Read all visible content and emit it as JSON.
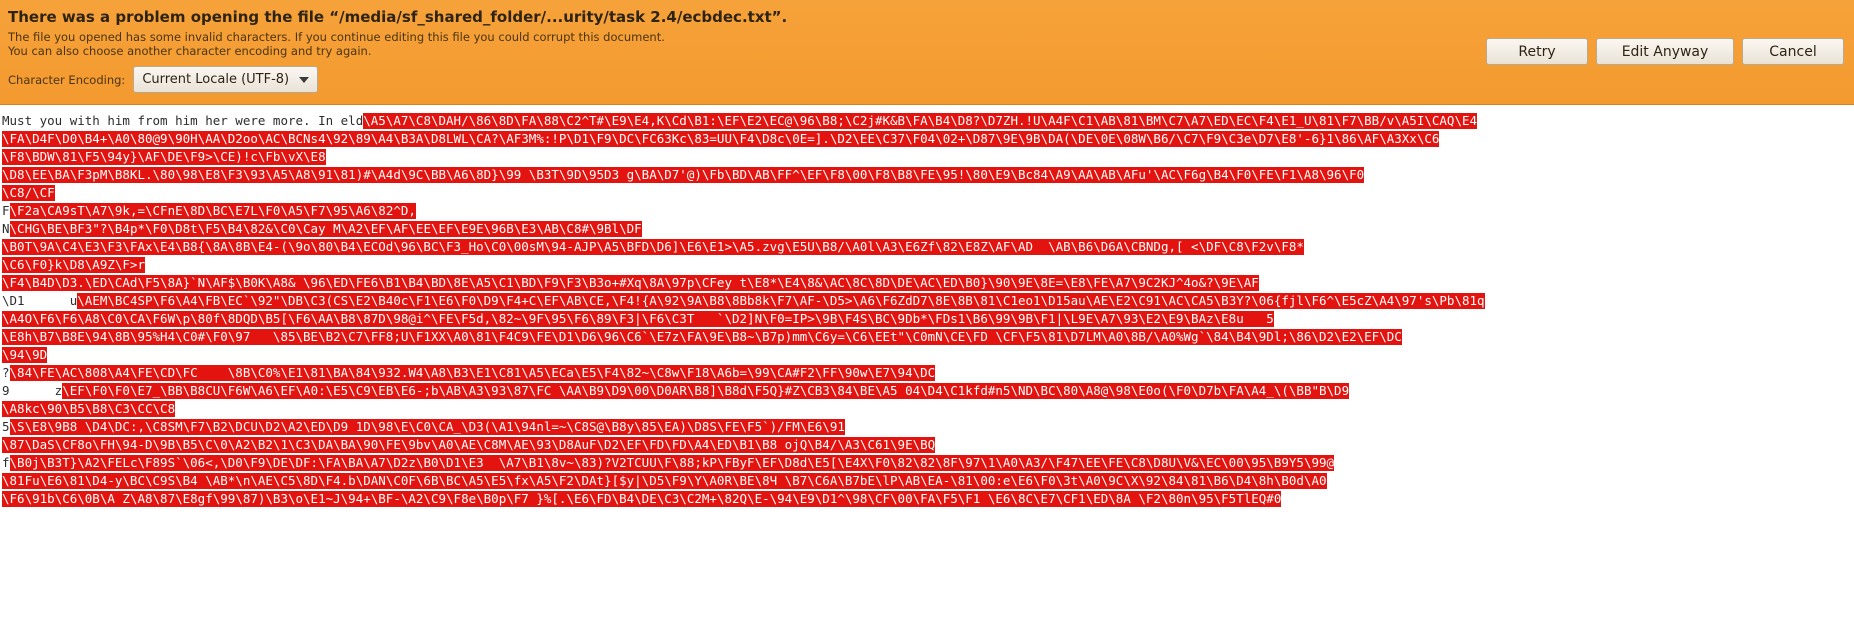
{
  "infobar": {
    "title": "There was a problem opening the file “/media/sf_shared_folder/...urity/task 2.4/ecbdec.txt”.",
    "desc_line1": "The file you opened has some invalid characters. If you continue editing this file you could corrupt this document.",
    "desc_line2": "You can also choose another character encoding and try again.",
    "encoding_label": "Character Encoding:",
    "encoding_value": "Current Locale (UTF-8)",
    "buttons": {
      "retry": "Retry",
      "edit_anyway": "Edit Anyway",
      "cancel": "Cancel"
    }
  },
  "editor": {
    "lines": [
      [
        {
          "t": "txt",
          "v": "Must you with him from him her were more. In eld"
        },
        {
          "t": "bad",
          "v": "\\A5\\A7\\C8\\DAH/\\86\\8D\\FA\\88\\C2^T#\\E9\\E4,K\\Cd\\B1:\\EF\\E2\\EC@\\96\\B8;\\C2j#K&B\\FA\\B4\\D8?\\D7ZH.!U\\A4F\\C1\\AB\\81\\BM\\C7\\A7\\ED\\EC\\F4\\E1_U\\81\\F7\\BB/v\\A5I\\CAQ\\E4"
        }
      ],
      [
        {
          "t": "bad",
          "v": "\\FA\\D4F\\D0\\B4+\\A0\\80@9\\90H\\AA\\D2oo\\AC\\BCNs4\\92\\89\\A4\\B3A\\D8LWL\\CA?\\AF3M%:!P\\D1\\F9\\DC\\FC63Kc\\83=UU\\F4\\D8c\\0E=].\\D2\\EE\\C37\\F04\\02+\\D87\\9E\\9B\\DA(\\DE\\0E\\08W\\B6/\\C7\\F9\\C3e\\D7\\E8'-6}1\\86\\AF\\A3Xx\\C6"
        }
      ],
      [
        {
          "t": "bad",
          "v": "\\F8\\BDW\\81\\F5\\94y}\\AF\\DE\\F9>\\CE)!c\\Fb\\vX\\E8"
        }
      ],
      [
        {
          "t": "bad",
          "v": "\\D8\\EE\\BA\\F3pM\\B8KL.\\80\\98\\E8\\F3\\93\\A5\\A8\\91\\81)#\\A4d\\9C\\BB\\A6\\8D}\\99 \\B3T\\9D\\95D3 g\\BA\\D7'@)\\Fb\\BD\\AB\\FF^\\EF\\F8\\00\\F8\\B8\\FE\\95!\\80\\E9\\Bc84\\A9\\AA\\AB\\AFu'\\AC\\F6g\\B4\\F0\\FE\\F1\\A8\\96\\F0"
        }
      ],
      [
        {
          "t": "bad",
          "v": "\\C8/\\CF"
        }
      ],
      [
        {
          "t": "txt",
          "v": "F"
        },
        {
          "t": "bad",
          "v": "\\F2a\\CA9sT\\A7\\9k,=\\CFnE\\8D\\BC\\E7L\\F0\\A5\\F7\\95\\A6\\82^D,"
        }
      ],
      [
        {
          "t": "txt",
          "v": "N"
        },
        {
          "t": "bad",
          "v": "\\CHG\\BE\\BF3\"?\\B4p*\\F0\\D8t\\F5\\B4\\82&\\C0\\Cay M\\A2\\EF\\AF\\EE\\EF\\E9E\\96B\\E3\\AB\\C8#\\9Bl\\DF"
        }
      ],
      [
        {
          "t": "bad",
          "v": "\\B0T\\9A\\C4\\E3\\F3\\FAx\\E4\\B8{\\8A\\8B\\E4-(\\9o\\80\\B4\\ECOd\\96\\BC\\F3_Ho\\C0\\00sM\\94-AJP\\A5\\BFD\\D6]\\E6\\E1>\\A5.zvg\\E5U\\B8/\\A0l\\A3\\E6Zf\\82\\E8Z\\AF\\AD  \\AB\\B6\\D6A\\CBNDg,[ <\\DF\\C8\\F2v\\F8*"
        }
      ],
      [
        {
          "t": "bad",
          "v": "\\C6\\F0}k\\D8\\A9Z\\F>r"
        }
      ],
      [
        {
          "t": "bad",
          "v": "\\F4\\B4D\\D3.\\ED\\CAd\\F5\\8A}`N\\AF$\\B0K\\A8& \\96\\ED\\FE6\\B1\\B4\\BD\\8E\\A5\\C1\\BD\\F9\\F3\\B3o+#Xq\\8A\\97p\\CFey t\\E8*\\E4\\8&\\AC\\8C\\8D\\DE\\AC\\ED\\B0}\\90\\9E\\8E=\\E8\\FE\\A7\\9C2KJ^4o&?\\9E\\AF"
        }
      ],
      [
        {
          "t": "txt",
          "v": "\\D1      u"
        },
        {
          "t": "bad",
          "v": "\\AEM\\BC4SP\\F6\\A4\\FB\\EC`\\92\"\\DB\\C3(CS\\E2\\B40c\\F1\\E6\\F0\\D9\\F4+C\\EF\\AB\\CE,\\F4!{A\\92\\9A\\B8\\8Bb8k\\F7\\AF-\\D5>\\A6\\F6ZdD7\\8E\\8B\\81\\C1eo1\\D15au\\AE\\E2\\C91\\AC\\CA5\\B3Y?\\06{fjl\\F6^\\E5cZ\\A4\\97's\\Pb\\81q"
        }
      ],
      [
        {
          "t": "bad",
          "v": "\\A4O\\F6\\F6\\A8\\C0\\CA\\F6W\\p\\80f\\8DQD\\B5[\\F6\\AA\\B8\\87D\\98@i^\\FE\\F5d,\\82~\\9F\\95\\F6\\89\\F3|\\F6\\C3T   `\\D2]N\\F0=IP>\\9B\\F4S\\BC\\9Db*\\FDs1\\B6\\99\\9B\\F1|\\L9E\\A7\\93\\E2\\E9\\BAz\\E8u   5"
        }
      ],
      [
        {
          "t": "bad",
          "v": "\\E8h\\B7\\B8E\\94\\8B\\95%H4\\C0#\\F0\\97   \\85\\BE\\B2\\C7\\FF8;U\\F1XX\\A0\\81\\F4C9\\FE\\D1\\D6\\96\\C6`\\E7z\\FA\\9E\\B8~\\B7p)mm\\C6y=\\C6\\EEt\"\\C0mN\\CE\\FD \\CF\\F5\\81\\D7LM\\A0\\8B/\\A0%Wg`\\84\\B4\\9Dl;\\86\\D2\\E2\\EF\\DC"
        }
      ],
      [
        {
          "t": "bad",
          "v": "\\94\\9D"
        }
      ],
      [
        {
          "t": "txt",
          "v": "?"
        },
        {
          "t": "bad",
          "v": "\\84\\FE\\AC\\808\\A4\\FE\\CD\\FC    \\8B\\C0%\\E1\\81\\BA\\84\\932.W4\\A8\\B3\\E1\\C81\\A5\\ECa\\E5\\F4\\82~\\C8w\\F18\\A6b=\\99\\CA#F2\\FF\\90w\\E7\\94\\DC"
        }
      ],
      [
        {
          "t": "txt",
          "v": "9      z"
        },
        {
          "t": "bad",
          "v": "\\EF\\F0\\F0\\E7_\\BB\\B8CU\\F6W\\A6\\EF\\A0:\\E5\\C9\\EB\\E6-;b\\AB\\A3\\93\\87\\FC \\AA\\B9\\D9\\00\\D0AR\\B8]\\B8d\\F5Q}#Z\\CB3\\84\\BE\\A5 04\\D4\\C1kfd#n5\\ND\\BC\\80\\A8@\\98\\E0o(\\F0\\D7b\\FA\\A4_\\(\\BB\"B\\D9"
        }
      ],
      [
        {
          "t": "bad",
          "v": "\\A8kc\\90\\B5\\B8\\C3\\CC\\C8"
        }
      ],
      [
        {
          "t": "txt",
          "v": "5"
        },
        {
          "t": "bad",
          "v": "\\S\\E8\\9B8 \\D4\\DC:,\\C8SM\\F7\\B2\\DCU\\D2\\A2\\ED\\D9 1D\\98\\E\\C0\\CA_\\D3(\\A1\\94nl=~\\C8S@\\B8y\\85\\EA)\\D8S\\FE\\F5`)/FM\\E6\\91"
        }
      ],
      [
        {
          "t": "bad",
          "v": "\\87\\DaS\\CF8o\\FH\\94-D\\9B\\B5\\C\\0\\A2\\B2\\1\\C3\\DA\\BA\\90\\FE\\9bv\\A0\\AE\\C8M\\AE\\93\\D8AuF\\D2\\EF\\FD\\FD\\A4\\ED\\B1\\B8 ojQ\\B4/\\A3\\C61\\9E\\BQ"
        }
      ],
      [
        {
          "t": "txt",
          "v": "f"
        },
        {
          "t": "bad",
          "v": "\\B0j\\B3T}\\A2\\FELc\\F89S`\\06<,\\D0\\F9\\DE\\DF:\\FA\\BA\\A7\\D2z\\B0\\D1\\E3  \\A7\\B1\\8v~\\83)?V2TCUU\\F\\88;kP\\FByF\\EF\\D8d\\E5[\\E4X\\F0\\82\\82\\8F\\97\\1\\A0\\A3/\\F47\\EE\\FE\\C8\\D8U\\V&\\EC\\00\\95\\B9Y5\\99@"
        }
      ],
      [
        {
          "t": "bad",
          "v": "\\81Fu\\E6\\81\\D4-y\\BC\\C9S\\B4 \\AB*\\n\\AE\\C5\\8D\\F4.b\\DAN\\C0F\\6B\\BC\\A5\\E5\\fx\\A5\\F2\\DAt}[$y|\\D5\\F9\\Y\\A0R\\BE\\8Ч \\B7\\C6A\\B7bE\\lP\\AB\\EA-\\81\\00:e\\E6\\F0\\3t\\A0\\9C\\X\\92\\84\\81\\B6\\D4\\8h\\B0d\\A0"
        }
      ],
      [
        {
          "t": "bad",
          "v": "\\F6\\91b\\C6\\0B\\A Z\\A8\\87\\E8gf\\99\\87)\\B3\\o\\E1~J\\94+\\BF-\\A2\\C9\\F8e\\B0p\\F7 }%[.\\E6\\FD\\B4\\DE\\C3\\C2M+\\82Q\\E-\\94\\E9\\D1^\\98\\CF\\00\\FA\\F5\\F1 \\E6\\8C\\E7\\CF1\\ED\\8A \\F2\\80n\\95\\F5TlEQ#0"
        }
      ]
    ]
  }
}
